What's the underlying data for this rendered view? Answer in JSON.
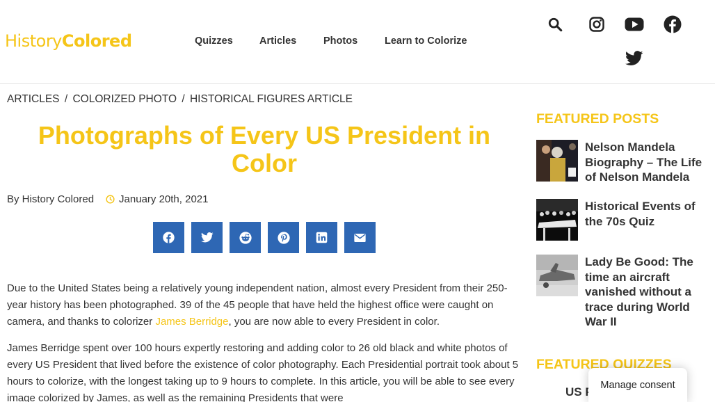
{
  "header": {
    "logo_part1": "History",
    "logo_part2": "Colored",
    "nav": [
      {
        "label": "Quizzes"
      },
      {
        "label": "Articles"
      },
      {
        "label": "Photos"
      },
      {
        "label": "Learn to Colorize"
      }
    ],
    "icons": [
      "search-icon",
      "instagram-icon",
      "youtube-icon",
      "facebook-icon",
      "twitter-icon"
    ]
  },
  "breadcrumb": {
    "items": [
      "ARTICLES",
      "COLORIZED PHOTO",
      "HISTORICAL FIGURES ARTICLE"
    ],
    "separator": "/"
  },
  "article": {
    "title": "Photographs of Every US President in Color",
    "author": "By History Colored",
    "date": "January 20th, 2021",
    "share_buttons": [
      "facebook",
      "twitter",
      "reddit",
      "pinterest",
      "linkedin",
      "email"
    ],
    "p1_before": "Due to the United States being a relatively young independent nation, almost every President from their 250-year history has been photographed. 39 of the 45 people that have held the highest office were caught on camera, and thanks to colorizer ",
    "p1_link": "James Berridge",
    "p1_after": ", you are now able to every President in color.",
    "p2": "James Berridge spent over 100 hours expertly restoring and adding color to 26 old black and white photos of every US President that lived before the existence of color photography. Each Presidential portrait took about 5 hours to colorize, with the longest taking up to 9 hours to complete. In this article, you will be able to see every image colorized by James, as well as the remaining Presidents that were"
  },
  "sidebar": {
    "featured_posts_heading": "FEATURED POSTS",
    "posts": [
      {
        "title": "Nelson Mandela Biography – The Life of Nelson Mandela"
      },
      {
        "title": "Historical Events of the 70s Quiz"
      },
      {
        "title": "Lady Be Good: The time an aircraft vanished without a trace during World War II"
      }
    ],
    "featured_quizzes_heading": "FEATURED QUIZZES",
    "quiz_partial": "US P"
  },
  "consent": {
    "label": "Manage consent"
  },
  "colors": {
    "accent": "#f5c518",
    "share": "#2e67b4",
    "text": "#333333"
  }
}
